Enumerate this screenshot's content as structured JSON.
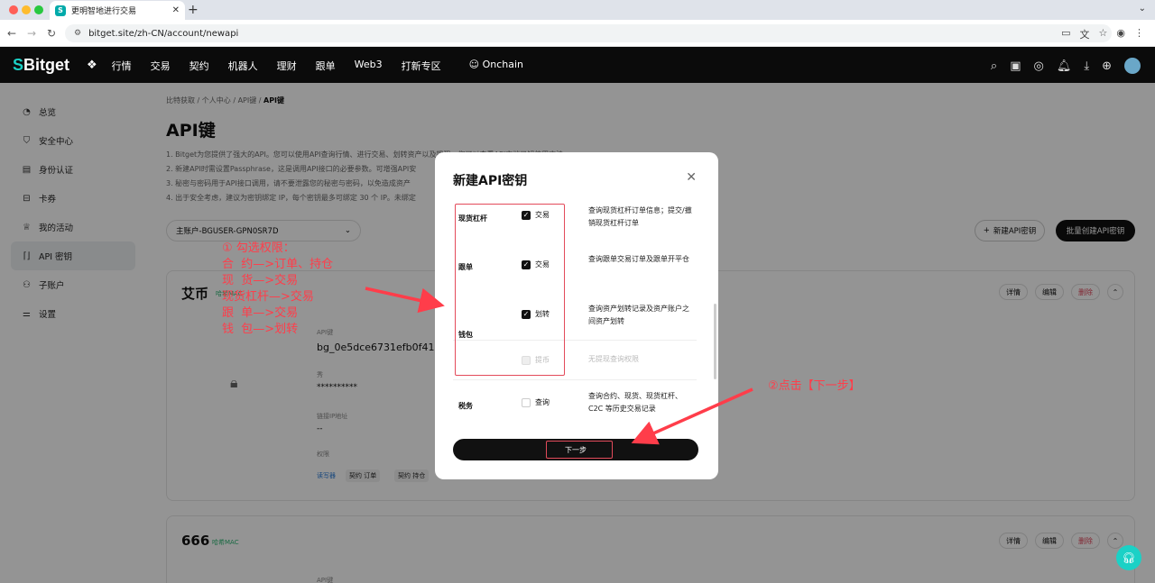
{
  "browser": {
    "tab_title": "更明智地进行交易",
    "favicon": "S",
    "url": "bitget.site/zh-CN/account/newapi"
  },
  "header": {
    "logo_mark": "S",
    "logo_text": "Bitget",
    "nav": [
      "行情",
      "交易",
      "契约",
      "机器人",
      "理财",
      "跟单",
      "Web3",
      "打新专区"
    ],
    "onchain": "Onchain"
  },
  "sidebar": {
    "items": [
      {
        "label": "总览",
        "icon": "dashboard-icon"
      },
      {
        "label": "安全中心",
        "icon": "shield-icon"
      },
      {
        "label": "身份认证",
        "icon": "id-card-icon"
      },
      {
        "label": "卡券",
        "icon": "coupon-icon"
      },
      {
        "label": "我的活动",
        "icon": "trophy-icon"
      },
      {
        "label": "API 密钥",
        "icon": "api-icon"
      },
      {
        "label": "子账户",
        "icon": "sub-account-icon"
      },
      {
        "label": "设置",
        "icon": "settings-icon"
      }
    ]
  },
  "page": {
    "breadcrumb": [
      "比特获取",
      "个人中心",
      "API键",
      "API键"
    ],
    "title": "API键",
    "notes": [
      "1. Bitget为您提供了强大的API。您可以使用API查询行情、进行交易、划转资产以及提现。您可以查看API文档了解使用方法。",
      "2. 新建API时需设置Passphrase，这是调用API接口的必要参数。可增强API安",
      "3. 秘密与密码用于API接口调用，请不要泄露您的秘密与密码，以免造成资产",
      "4. 出于安全考虑，建议为密钥绑定 IP，每个密钥最多可绑定 30 个 IP。未绑定"
    ],
    "account_select": "主账户-BGUSER-GPN0SR7D",
    "btn_new": "新建API密钥",
    "btn_batch": "批量创建API密钥"
  },
  "cards": [
    {
      "name": "艾币",
      "badge": "哈希MAC",
      "actions": [
        "详情",
        "编辑",
        "删除"
      ],
      "api_label": "API键",
      "api_value": "bg_0e5dce6731efb0f41",
      "secret_label": "秀",
      "secret_value": "**********",
      "ip_label": "链接IP地址",
      "ip_value": "--",
      "perm_label": "权限",
      "perm_mode": "读写器",
      "perm_tags": [
        "契约 订单",
        "契约 持仓"
      ]
    },
    {
      "name": "666",
      "badge": "哈希MAC",
      "actions": [
        "详情",
        "编辑",
        "删除"
      ],
      "api_label": "API键"
    }
  ],
  "modal": {
    "title": "新建API密钥",
    "rows": [
      {
        "category": "现货杠杆",
        "option": "交易",
        "checked": true,
        "desc": "查询现货杠杆订单信息；提交/撤销现货杠杆订单"
      },
      {
        "category": "跟单",
        "option": "交易",
        "checked": true,
        "desc": "查询跟单交易订单及跟单开平仓"
      },
      {
        "category": "钱包",
        "option": "划转",
        "checked": true,
        "desc": "查询资产划转记录及资产账户之间资产划转"
      },
      {
        "category": "",
        "option": "提币",
        "checked": false,
        "disabled": true,
        "desc": "无提现查询权限"
      },
      {
        "category": "税务",
        "option": "查询",
        "checked": false,
        "desc": "查询合约、现货、现货杠杆、C2C 等历史交易记录"
      }
    ],
    "next": "下一步"
  },
  "annotations": {
    "step1": "① 勾选权限：\n合  约—>订单、持仓\n现  货—>交易\n现货杠杆—>交易\n跟  单—>交易\n钱  包—>划转",
    "step2": "②点击【下一步】"
  },
  "colors": {
    "brand": "#1bd1c6",
    "annotation_red": "#ff3d4a",
    "delete_red": "#e0455a"
  }
}
